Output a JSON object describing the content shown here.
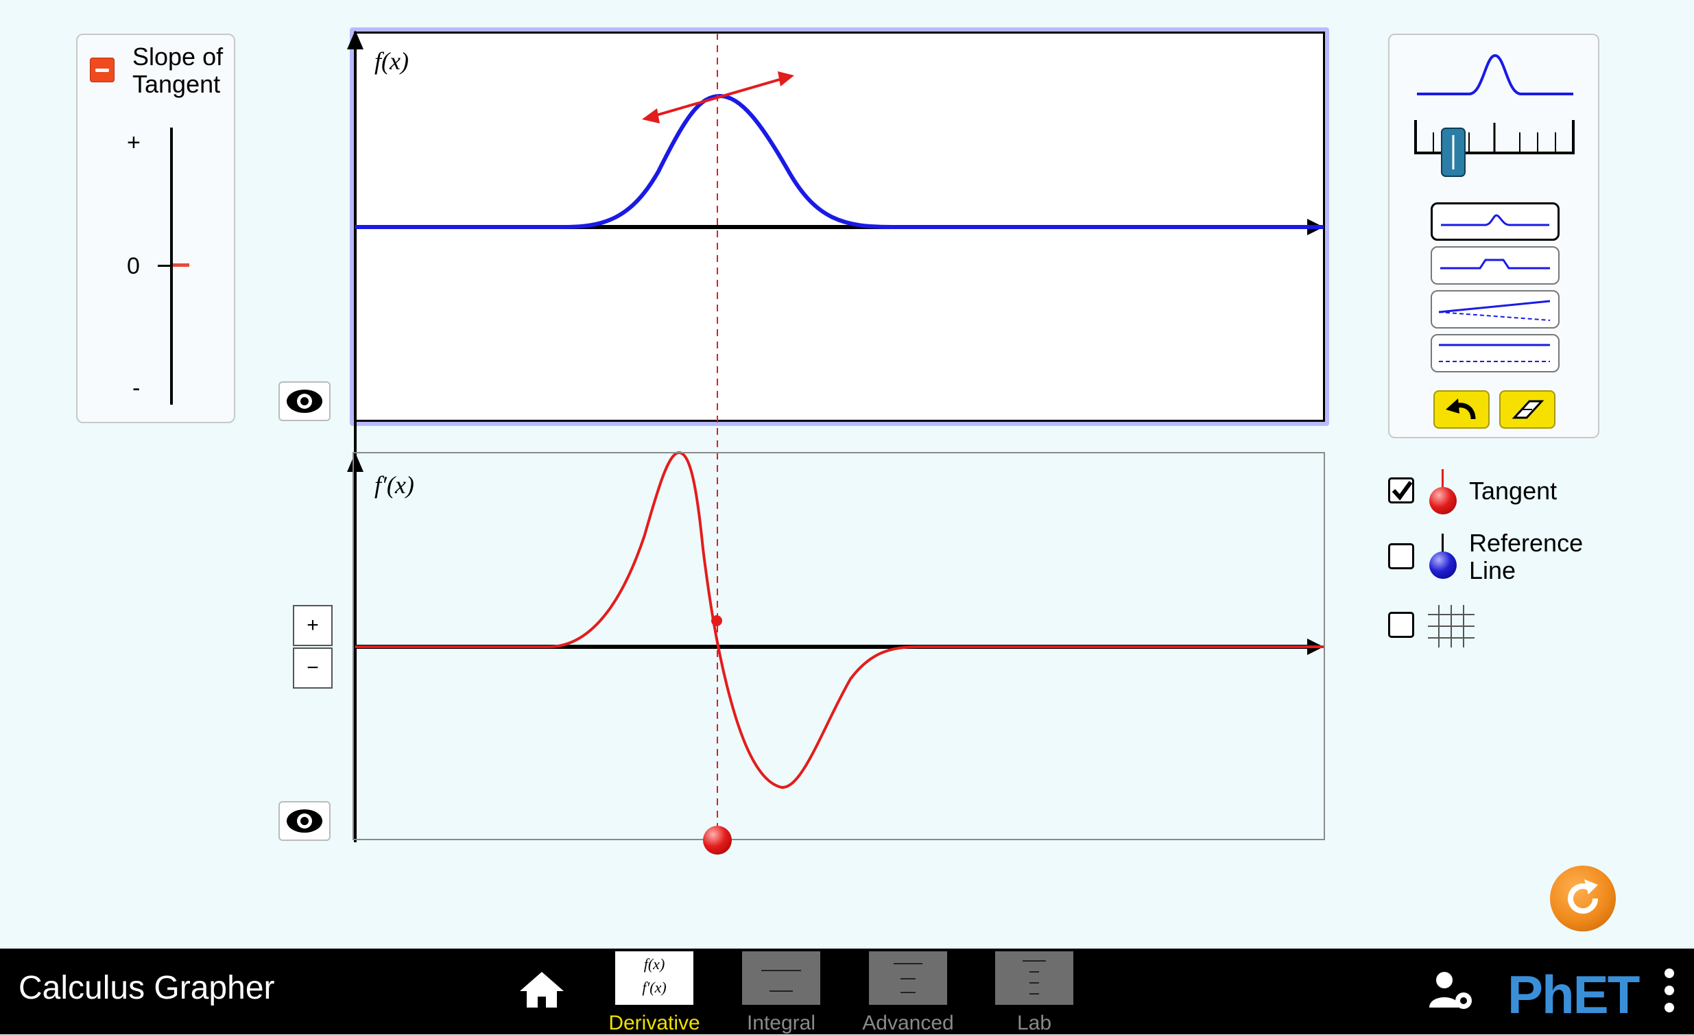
{
  "slope_panel": {
    "title_line1": "Slope of",
    "title_line2": "Tangent",
    "plus": "+",
    "zero": "0",
    "minus": "-",
    "slope_value_fraction": 0.5
  },
  "top_graph": {
    "label": "f(x)"
  },
  "bottom_graph": {
    "label": "f′(x)"
  },
  "zoom": {
    "in": "+",
    "out": "−"
  },
  "checkboxes": [
    {
      "label": "Tangent",
      "checked": true,
      "color": "#e41c1c"
    },
    {
      "label_line1": "Reference",
      "label_line2": "Line",
      "checked": false,
      "color": "#2020d0"
    },
    {
      "label": "",
      "checked": false,
      "icon": "grid-icon"
    }
  ],
  "navbar": {
    "title": "Calculus Grapher",
    "tabs": [
      {
        "label": "Derivative",
        "icon_line1": "f(x)",
        "icon_line2": "f′(x)",
        "active": true
      },
      {
        "label": "Integral",
        "active": false
      },
      {
        "label": "Advanced",
        "active": false
      },
      {
        "label": "Lab",
        "active": false
      }
    ],
    "logo": "PhET"
  },
  "colors": {
    "function_blue": "#1a1ae6",
    "derivative_red": "#e41c1c",
    "active_tab": "#f0e000",
    "inactive_tab": "#8a8a8a",
    "reset_orange": "#f08a1c"
  }
}
